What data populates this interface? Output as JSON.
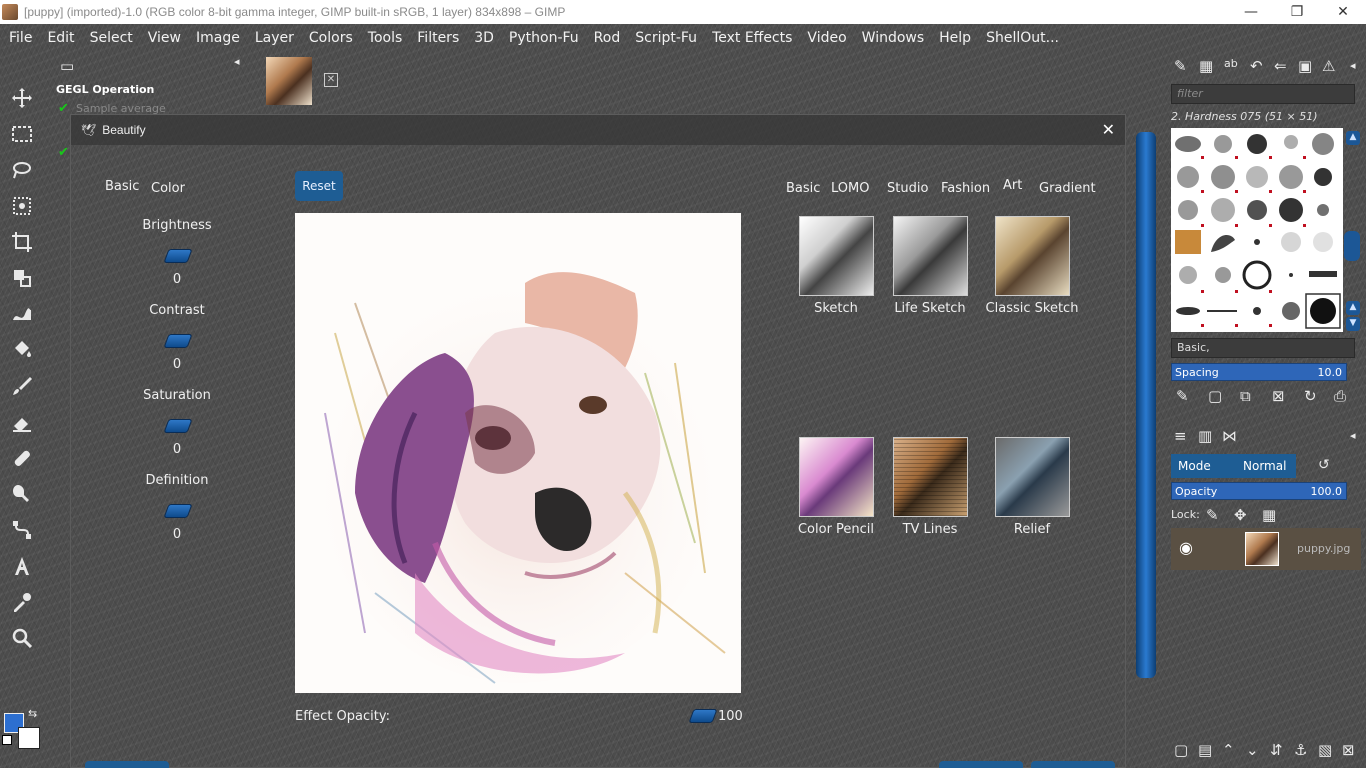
{
  "window": {
    "title": "[puppy] (imported)-1.0 (RGB color 8-bit gamma integer, GIMP built-in sRGB, 1 layer) 834x898 – GIMP",
    "controls": [
      "—",
      "❐",
      "✕"
    ]
  },
  "menu": [
    "File",
    "Edit",
    "Select",
    "View",
    "Image",
    "Layer",
    "Colors",
    "Tools",
    "Filters",
    "3D",
    "Python-Fu",
    "Rod",
    "Script-Fu",
    "Text Effects",
    "Video",
    "Windows",
    "Help",
    "ShellOut..."
  ],
  "left_dock": {
    "gegl_title": "GEGL Operation",
    "sample_average": "Sample average"
  },
  "image_tab": {
    "close_symbol": "✕"
  },
  "dialog": {
    "title": "Beautify",
    "close_symbol": "✕",
    "left_tabs": [
      "Basic",
      "Color"
    ],
    "reset_label": "Reset",
    "adjustments": [
      {
        "label": "Brightness",
        "value": "0"
      },
      {
        "label": "Contrast",
        "value": "0"
      },
      {
        "label": "Saturation",
        "value": "0"
      },
      {
        "label": "Definition",
        "value": "0"
      }
    ],
    "effect_tabs": [
      "Basic",
      "LOMO",
      "Studio",
      "Fashion",
      "Art",
      "Gradient"
    ],
    "effects": [
      {
        "label": "Sketch"
      },
      {
        "label": "Life Sketch"
      },
      {
        "label": "Classic Sketch"
      },
      {
        "label": "Color Pencil"
      },
      {
        "label": "TV Lines"
      },
      {
        "label": "Relief"
      }
    ],
    "effect_opacity_label": "Effect Opacity:",
    "effect_opacity_value": "100"
  },
  "brushes": {
    "filter_placeholder": "filter",
    "current_brush": "2. Hardness 075 (51 × 51)",
    "tag": "Basic,",
    "spacing_label": "Spacing",
    "spacing_value": "10.0"
  },
  "layers": {
    "mode_label": "Mode",
    "mode_value": "Normal",
    "opacity_label": "Opacity",
    "opacity_value": "100.0",
    "lock_label": "Lock:",
    "layer_name": "puppy.jpg"
  },
  "colors": {
    "foreground": "#2d6fd0",
    "background": "#ffffff",
    "accent": "#1e5d94"
  }
}
